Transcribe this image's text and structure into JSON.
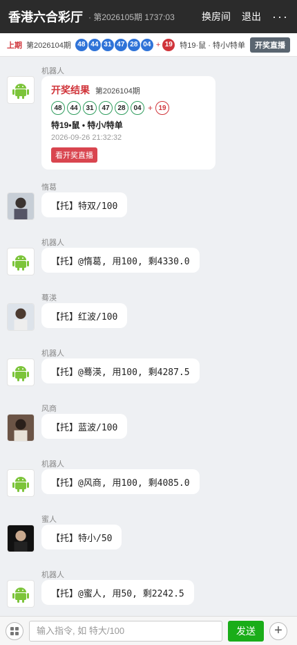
{
  "header": {
    "title": "香港六合彩厅",
    "subtitle": "· 第2026105期 1737:03",
    "switch_room": "换房间",
    "logout": "退出",
    "more": "···"
  },
  "result_bar": {
    "prev_label": "上期",
    "period": "第2026104期",
    "balls": [
      "48",
      "44",
      "31",
      "47",
      "28",
      "04"
    ],
    "plus": "+",
    "special_ball": "19",
    "description": "特19·鼠 · 特小/特单",
    "live_button": "开奖直播"
  },
  "chat": {
    "result_card": {
      "sender": "机器人",
      "title": "开奖结果",
      "period": "第2026104期",
      "balls": [
        "48",
        "44",
        "31",
        "47",
        "28",
        "04"
      ],
      "plus": "+",
      "special_ball": "19",
      "special_text": "特19•鼠 • 特小/特单",
      "time": "2026-09-26 21:32:32",
      "button": "看开奖直播"
    },
    "messages": [
      {
        "sender": "惰葛",
        "text": "【托】特双/100",
        "avatar": "user-photo-1"
      },
      {
        "sender": "机器人",
        "text": "【托】@惰葛, 用100, 剩4330.0",
        "avatar": "android-icon"
      },
      {
        "sender": "蓦渶",
        "text": "【托】红波/100",
        "avatar": "user-photo-2"
      },
      {
        "sender": "机器人",
        "text": "【托】@蓦渶, 用100, 剩4287.5",
        "avatar": "android-icon"
      },
      {
        "sender": "风商",
        "text": "【托】蓝波/100",
        "avatar": "user-photo-3"
      },
      {
        "sender": "机器人",
        "text": "【托】@风商, 用100, 剩4085.0",
        "avatar": "android-icon"
      },
      {
        "sender": "蜜人",
        "text": "【托】特小/50",
        "avatar": "user-photo-4"
      },
      {
        "sender": "机器人",
        "text": "【托】@蜜人, 用50, 剩2242.5",
        "avatar": "android-icon"
      }
    ]
  },
  "input_bar": {
    "placeholder": "输入指令, 如 特大/100",
    "send": "发送",
    "plus": "+"
  },
  "colors": {
    "header_bg": "#2b2b2b",
    "ball_blue": "#2f73d8",
    "accent_red": "#d0343a",
    "send_green": "#1aad19",
    "chat_bg": "#eef0f3"
  }
}
